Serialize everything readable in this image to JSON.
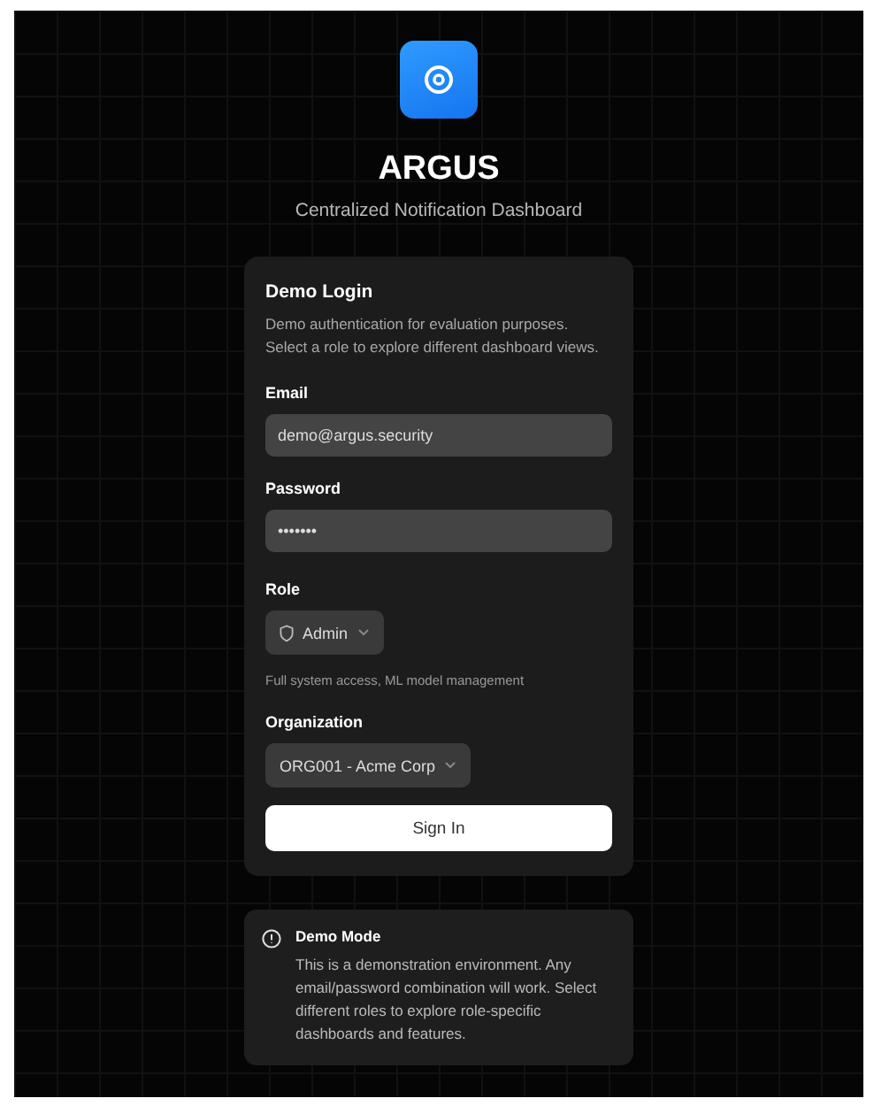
{
  "brand": {
    "name": "ARGUS",
    "subtitle": "Centralized Notification Dashboard"
  },
  "login": {
    "title": "Demo Login",
    "description": "Demo authentication for evaluation purposes. Select a role to explore different dashboard views.",
    "email": {
      "label": "Email",
      "value": "demo@argus.security"
    },
    "password": {
      "label": "Password",
      "value": "•••••••"
    },
    "role": {
      "label": "Role",
      "value": "Admin",
      "hint": "Full system access, ML model management"
    },
    "organization": {
      "label": "Organization",
      "value": "ORG001 - Acme Corp"
    },
    "submit": "Sign In"
  },
  "notice": {
    "title": "Demo Mode",
    "text": "This is a demonstration environment. Any email/password combination will work. Select different roles to explore role-specific dashboards and features."
  }
}
